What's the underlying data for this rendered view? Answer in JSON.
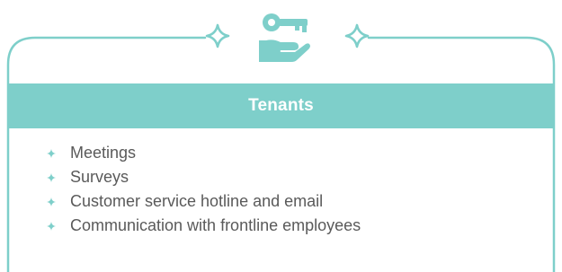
{
  "card": {
    "title": "Tenants",
    "icon": "key-on-hand-icon",
    "decoration_icon": "four-point-sparkle-icon",
    "bullet_icon": "four-point-star-bullet-icon",
    "accent_color": "#7ecfca",
    "text_color": "#5a5a5a",
    "items": [
      {
        "label": "Meetings"
      },
      {
        "label": "Surveys"
      },
      {
        "label": "Customer service hotline and email"
      },
      {
        "label": "Communication with frontline employees"
      }
    ]
  }
}
